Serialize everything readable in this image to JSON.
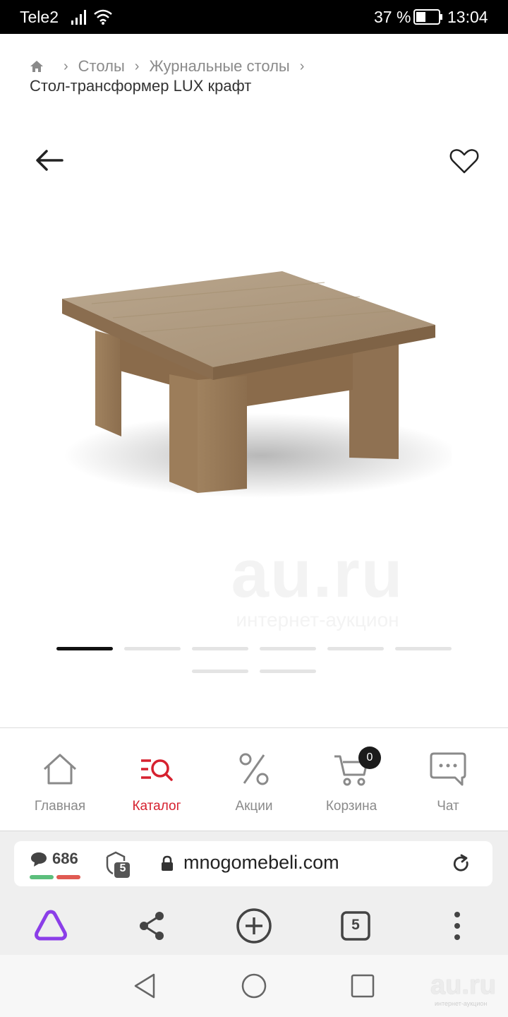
{
  "status_bar": {
    "carrier": "Tele2",
    "battery_percent": "37 %",
    "time": "13:04"
  },
  "breadcrumb": {
    "items": [
      "Столы",
      "Журнальные столы"
    ],
    "current": "Стол-трансформер LUX крафт"
  },
  "gallery": {
    "watermark_main": "au.ru",
    "watermark_sub": "интернет-аукцион",
    "dot_count": 8,
    "active_index": 0
  },
  "bottom_nav": {
    "items": [
      {
        "label": "Главная",
        "icon": "home-icon"
      },
      {
        "label": "Каталог",
        "icon": "catalog-search-icon",
        "active": true
      },
      {
        "label": "Акции",
        "icon": "percent-icon"
      },
      {
        "label": "Корзина",
        "icon": "cart-icon",
        "badge": "0"
      },
      {
        "label": "Чат",
        "icon": "chat-icon"
      }
    ]
  },
  "browser": {
    "comments_count": "686",
    "protect_count": "5",
    "url": "mnogomebeli.com",
    "tabs_count": "5"
  },
  "watermark_corner": {
    "logo": "au.ru",
    "sub": "интернет-аукцион"
  },
  "colors": {
    "accent": "#d6212f",
    "alice_purple": "#8b3ee8",
    "positive": "#5cbf7c",
    "negative": "#e05a52"
  }
}
